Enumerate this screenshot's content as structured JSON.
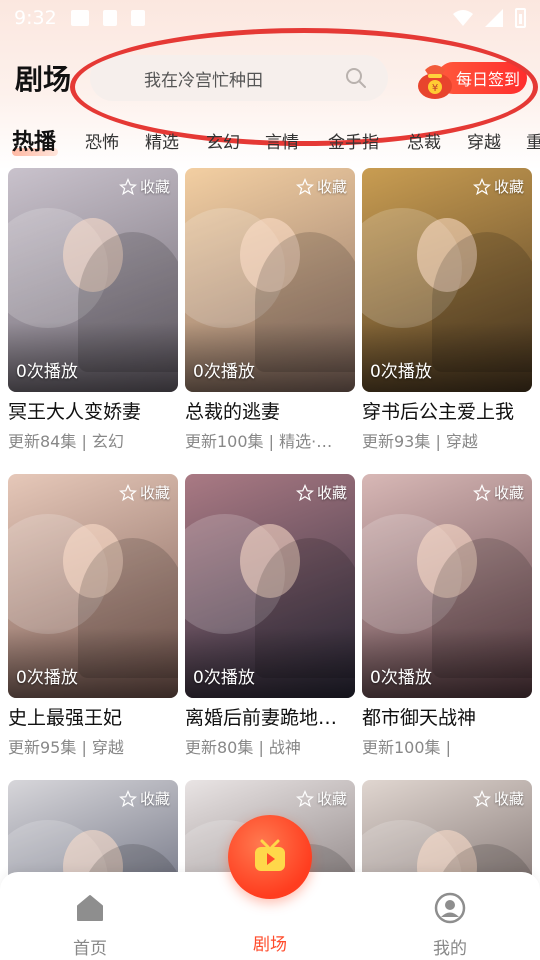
{
  "status_bar": {
    "time": "9:32"
  },
  "header": {
    "title": "剧场",
    "search_placeholder": "我在冷宫忙种田",
    "checkin_label": "每日签到"
  },
  "tabs": [
    "热播",
    "恐怖",
    "精选",
    "玄幻",
    "言情",
    "金手指",
    "总裁",
    "穿越",
    "重"
  ],
  "dramas": [
    {
      "title": "冥王大人变娇妻",
      "meta": "更新84集 | 玄幻",
      "plays": "0次播放",
      "fav": "收藏",
      "colors": [
        "#c9c2cc",
        "#6d6670"
      ]
    },
    {
      "title": "总裁的逃妻",
      "meta": "更新100集 | 精选·…",
      "plays": "0次播放",
      "fav": "收藏",
      "colors": [
        "#f3cfa2",
        "#8a6f64"
      ]
    },
    {
      "title": "穿书后公主爱上我",
      "meta": "更新93集 | 穿越",
      "plays": "0次播放",
      "fav": "收藏",
      "colors": [
        "#c99d52",
        "#4e3a22"
      ]
    },
    {
      "title": "史上最强王妃",
      "meta": "更新95集 | 穿越",
      "plays": "0次播放",
      "fav": "收藏",
      "colors": [
        "#e6c8b9",
        "#7a5a52"
      ]
    },
    {
      "title": "离婚后前妻跪地…",
      "meta": "更新80集 | 战神",
      "plays": "0次播放",
      "fav": "收藏",
      "colors": [
        "#aa7a84",
        "#2c2a3b"
      ]
    },
    {
      "title": "都市御天战神",
      "meta": "更新100集 |",
      "plays": "0次播放",
      "fav": "收藏",
      "colors": [
        "#d8b8b6",
        "#5a3d44"
      ]
    },
    {
      "title": "",
      "meta": "",
      "plays": "",
      "fav": "收藏",
      "colors": [
        "#d7d6da",
        "#3a3f55"
      ]
    },
    {
      "title": "",
      "meta": "",
      "plays": "",
      "fav": "收藏",
      "colors": [
        "#e9e4e4",
        "#5a4e4e"
      ]
    },
    {
      "title": "",
      "meta": "",
      "plays": "",
      "fav": "收藏",
      "colors": [
        "#e0d6d0",
        "#4e4040"
      ]
    }
  ],
  "bottom_nav": [
    {
      "label": "首页",
      "icon": "home-icon"
    },
    {
      "label": "剧场",
      "icon": "theater-icon"
    },
    {
      "label": "我的",
      "icon": "profile-icon"
    }
  ],
  "theme": {
    "accent": "#ff4a2a",
    "highlight": "#e53935"
  }
}
